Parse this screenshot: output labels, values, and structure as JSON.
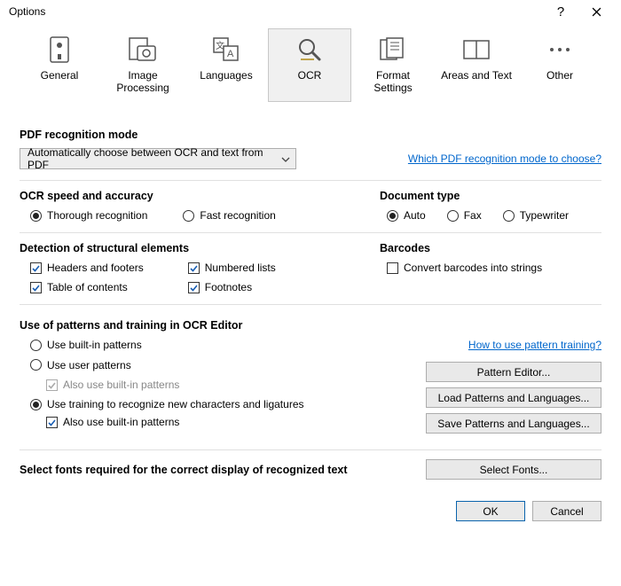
{
  "window": {
    "title": "Options",
    "help": "?",
    "close": "✕"
  },
  "tabs": {
    "general": "General",
    "image_processing": "Image\nProcessing",
    "languages": "Languages",
    "ocr": "OCR",
    "format_settings": "Format\nSettings",
    "areas_text": "Areas and Text",
    "other": "Other"
  },
  "pdf_mode": {
    "title": "PDF recognition mode",
    "dropdown_value": "Automatically choose between OCR and text from PDF",
    "help_link": "Which PDF recognition mode to choose?"
  },
  "speed": {
    "title": "OCR speed and accuracy",
    "thorough": "Thorough recognition",
    "fast": "Fast recognition"
  },
  "doc_type": {
    "title": "Document type",
    "auto": "Auto",
    "fax": "Fax",
    "typewriter": "Typewriter"
  },
  "structural": {
    "title": "Detection of structural elements",
    "headers": "Headers and footers",
    "numbered": "Numbered lists",
    "toc": "Table of contents",
    "footnotes": "Footnotes"
  },
  "barcodes": {
    "title": "Barcodes",
    "convert": "Convert barcodes into strings"
  },
  "patterns": {
    "title": "Use of patterns and training in OCR Editor",
    "builtin": "Use built-in patterns",
    "user": "Use user patterns",
    "also_builtin": "Also use built-in patterns",
    "training": "Use training to recognize new characters and ligatures",
    "also_builtin2": "Also use built-in patterns",
    "help_link": "How to use pattern training?",
    "pattern_editor": "Pattern Editor...",
    "load": "Load Patterns and Languages...",
    "save": "Save Patterns and Languages..."
  },
  "fonts": {
    "title": "Select fonts required for the correct display of recognized text",
    "button": "Select Fonts..."
  },
  "footer": {
    "ok": "OK",
    "cancel": "Cancel"
  }
}
